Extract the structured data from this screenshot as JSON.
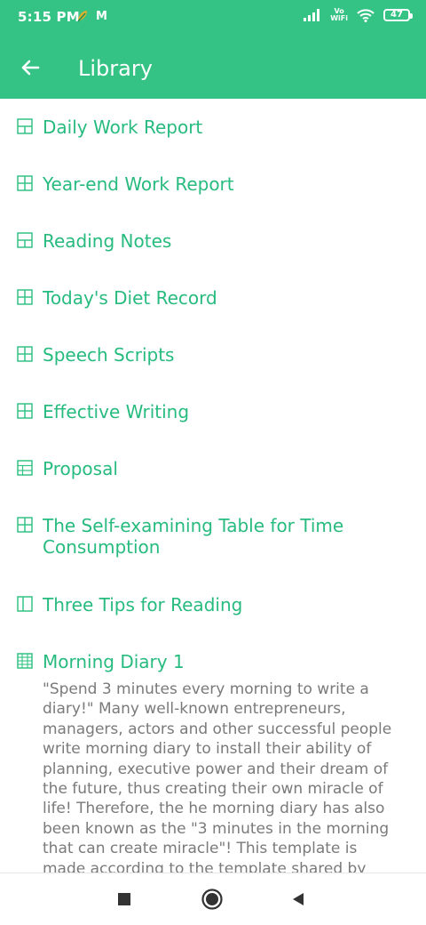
{
  "status_bar": {
    "time": "5:15 PM",
    "carrier_letters": "M",
    "volte_top": "Vo",
    "volte_bottom": "WiFi",
    "battery": "47"
  },
  "app_bar": {
    "title": "Library",
    "back_icon": "arrow-left-icon"
  },
  "colors": {
    "accent": "#34c384",
    "item_text": "#27bb7f",
    "desc_text": "#7a7a7a"
  },
  "library": {
    "items": [
      {
        "label": "Daily Work Report",
        "icon": "table-split-icon"
      },
      {
        "label": "Year-end Work Report",
        "icon": "table-grid-icon"
      },
      {
        "label": "Reading Notes",
        "icon": "table-split-icon"
      },
      {
        "label": "Today's Diet Record",
        "icon": "table-grid-icon"
      },
      {
        "label": "Speech Scripts",
        "icon": "table-grid-icon"
      },
      {
        "label": "Effective Writing",
        "icon": "table-grid-icon"
      },
      {
        "label": "Proposal",
        "icon": "table-grid-icon"
      },
      {
        "label": "The Self-examining Table for Time Consumption",
        "icon": "table-grid-icon"
      },
      {
        "label": "Three Tips for Reading",
        "icon": "table-split-icon"
      },
      {
        "label": "Morning Diary 1",
        "icon": "table-dense-icon",
        "description": "\"Spend 3 minutes every morning to write a diary!\" Many well-known entrepreneurs, managers, actors and other successful people write morning diary to install their ability of planning, executive power and their dream of the future, thus creating their own miracle of life! Therefore, the he morning diary has also been known as the \"3 minutes in the morning that can create miracle\"! This template is made according to the template shared by famous"
      }
    ]
  },
  "nav_bar": {
    "recents_icon": "square-icon",
    "home_icon": "circle-icon",
    "back_icon": "triangle-back-icon"
  }
}
